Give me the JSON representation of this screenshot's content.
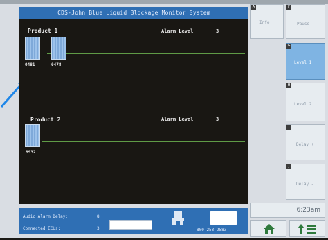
{
  "window": {
    "title": "CDS-John Blue Liquid Blockage Monitor System"
  },
  "products": [
    {
      "title": "Product 1",
      "alarm_label": "Alarm Level",
      "alarm_value": "3",
      "sensors": [
        {
          "id": "0481"
        },
        {
          "id": "0478"
        }
      ]
    },
    {
      "title": "Product 2",
      "alarm_label": "Alarm Level",
      "alarm_value": "3",
      "sensors": [
        {
          "id": "8932"
        }
      ]
    }
  ],
  "status": {
    "audio_label": "Audio Alarm Delay:",
    "audio_value": "8",
    "ecu_label": "Connected ECUs:",
    "ecu_value": "3",
    "phone": "800-253-2583"
  },
  "softkeys": [
    {
      "letter": "A",
      "label": "Info",
      "active": false
    },
    {
      "letter": "F",
      "label": "Pause",
      "active": false
    },
    {
      "letter": "G",
      "label": "Level 1",
      "active": true
    },
    {
      "letter": "H",
      "label": "Level 2",
      "active": false
    },
    {
      "letter": "I",
      "label": "Delay +",
      "active": false
    },
    {
      "letter": "J",
      "label": "Delay -",
      "active": false
    }
  ],
  "clock": "6:23am",
  "icons": {
    "home": "home-icon",
    "up": "arrow-up-list-icon",
    "tractor": "tractor-icon",
    "logo": "john-blue-logo"
  },
  "colors": {
    "accent_blue": "#2f6fb4",
    "sensor_blue": "#8fb7e4",
    "track_green": "#5f9b46",
    "active_key": "#7fb4e3"
  }
}
